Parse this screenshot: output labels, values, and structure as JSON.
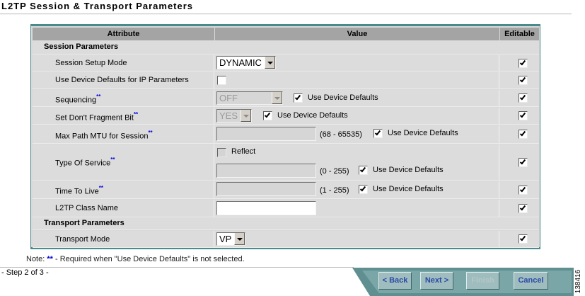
{
  "title": "L2TP Session & Transport Parameters",
  "table": {
    "headers": {
      "attribute": "Attribute",
      "value": "Value",
      "editable": "Editable"
    },
    "sections": {
      "session": "Session Parameters",
      "transport": "Transport Parameters"
    },
    "rows": {
      "session_setup_mode": {
        "label": "Session Setup Mode",
        "value": "DYNAMIC",
        "editable": true
      },
      "use_device_defaults_ip": {
        "label": "Use Device Defaults for IP Parameters",
        "checked": false,
        "editable": true
      },
      "sequencing": {
        "label": "Sequencing",
        "value": "OFF",
        "use_defaults_label": "Use Device Defaults",
        "use_defaults": true,
        "editable": true
      },
      "dont_fragment": {
        "label": "Set Don't Fragment Bit",
        "value": "YES",
        "use_defaults_label": "Use Device Defaults",
        "use_defaults": true,
        "editable": true
      },
      "max_path_mtu": {
        "label": "Max Path MTU for Session",
        "value": "",
        "range": "(68 - 65535)",
        "use_defaults_label": "Use Device Defaults",
        "use_defaults": true,
        "editable": true
      },
      "type_of_service": {
        "label": "Type Of Service",
        "reflect_label": "Reflect",
        "reflect": false,
        "value": "",
        "range": "(0 - 255)",
        "use_defaults_label": "Use Device Defaults",
        "use_defaults": true,
        "editable": true
      },
      "time_to_live": {
        "label": "Time To Live",
        "value": "",
        "range": "(1 - 255)",
        "use_defaults_label": "Use Device Defaults",
        "use_defaults": true,
        "editable": true
      },
      "l2tp_class_name": {
        "label": "L2TP Class Name",
        "value": "",
        "editable": true
      },
      "transport_mode": {
        "label": "Transport Mode",
        "value": "VP",
        "editable": true
      }
    },
    "required_marker": "**"
  },
  "note": {
    "prefix": "Note: ",
    "stars": "**",
    "text": " - Required when \"Use Device Defaults\" is not selected."
  },
  "step": "- Step 2 of 3 -",
  "wizard": {
    "back": "< Back",
    "next": "Next >",
    "finish": "Finish",
    "cancel": "Cancel"
  },
  "figure_id": "138416"
}
